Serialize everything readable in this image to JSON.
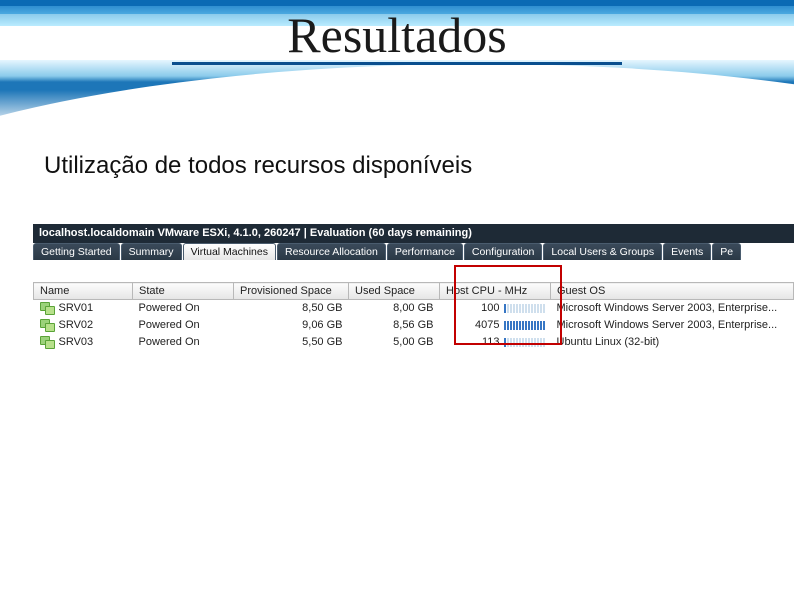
{
  "slide_title": "Resultados",
  "subtitle": "Utilização de todos recursos disponíveis",
  "hostbar": "localhost.localdomain VMware ESXi, 4.1.0, 260247 | Evaluation (60 days remaining)",
  "tabs": [
    {
      "label": "Getting Started",
      "active": false
    },
    {
      "label": "Summary",
      "active": false
    },
    {
      "label": "Virtual Machines",
      "active": true
    },
    {
      "label": "Resource Allocation",
      "active": false
    },
    {
      "label": "Performance",
      "active": false
    },
    {
      "label": "Configuration",
      "active": false
    },
    {
      "label": "Local Users & Groups",
      "active": false
    },
    {
      "label": "Events",
      "active": false
    },
    {
      "label": "Pe",
      "active": false
    }
  ],
  "columns": {
    "name": "Name",
    "state": "State",
    "prov": "Provisioned Space",
    "used": "Used Space",
    "cpu": "Host CPU - MHz",
    "guest": "Guest OS"
  },
  "rows": [
    {
      "name": "SRV01",
      "state": "Powered On",
      "prov": "8,50 GB",
      "used": "8,00 GB",
      "cpu": "100",
      "cpu_fill": 1,
      "guest": "Microsoft Windows Server 2003, Enterprise..."
    },
    {
      "name": "SRV02",
      "state": "Powered On",
      "prov": "9,06 GB",
      "used": "8,56 GB",
      "cpu": "4075",
      "cpu_fill": 14,
      "guest": "Microsoft Windows Server 2003, Enterprise..."
    },
    {
      "name": "SRV03",
      "state": "Powered On",
      "prov": "5,50 GB",
      "used": "5,00 GB",
      "cpu": "113",
      "cpu_fill": 1,
      "guest": "Ubuntu Linux (32-bit)"
    }
  ]
}
